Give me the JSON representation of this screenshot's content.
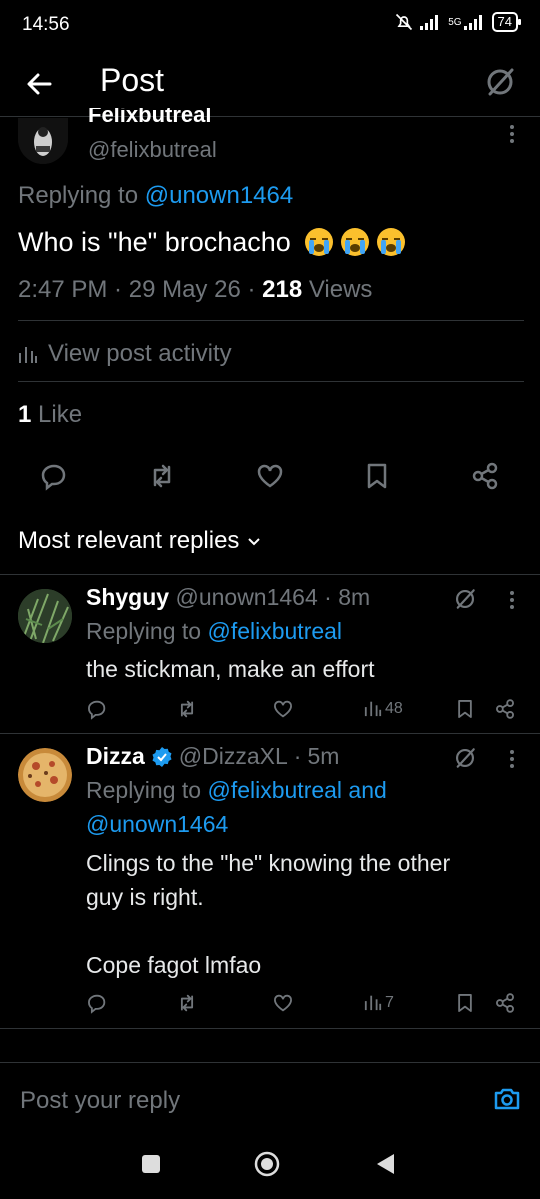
{
  "status_bar": {
    "time": "14:56",
    "network": "5G",
    "battery": "74"
  },
  "header": {
    "title": "Post"
  },
  "main_post": {
    "display_name": "Felixbutreal",
    "handle": "@felixbutreal",
    "replying_prefix": "Replying to ",
    "replying_to": "@unown1464",
    "text": "Who is \"he\" brochacho",
    "emojis": "😭😭😭",
    "time": "2:47 PM",
    "date": "29 May 26",
    "views_count": "218",
    "views_label": " Views",
    "view_activity": "View post activity",
    "likes_count": "1",
    "likes_label": " Like"
  },
  "sort": {
    "label": "Most relevant replies"
  },
  "replies": [
    {
      "display_name": "Shyguy",
      "handle": "@unown1464",
      "time": "8m",
      "replying_prefix": "Replying to ",
      "replying_to": "@felixbutreal",
      "text": "the stickman, make an effort",
      "views": "48"
    },
    {
      "display_name": "Dizza",
      "handle": "@DizzaXL",
      "time": "5m",
      "replying_prefix": "Replying to ",
      "replying_to": "@felixbutreal and",
      "replying_to_2": "@unown1464",
      "text_line1": "Clings to the \"he\" knowing the other",
      "text_line2": "guy is right.",
      "text_line3": "Cope fagot lmfao",
      "views": "7"
    }
  ],
  "compose": {
    "placeholder": "Post your reply"
  },
  "colors": {
    "accent": "#1d9bf0",
    "muted": "#71767b",
    "background": "#000000",
    "divider": "#2f3336"
  },
  "icons": {
    "back": "arrow-left-icon",
    "grok": "grok-icon",
    "more": "more-vertical-icon",
    "reply": "reply-icon",
    "repost": "repost-icon",
    "like": "heart-icon",
    "bookmark": "bookmark-icon",
    "share": "share-icon",
    "analytics": "bar-chart-icon",
    "verified": "verified-badge-icon",
    "camera": "camera-icon"
  }
}
